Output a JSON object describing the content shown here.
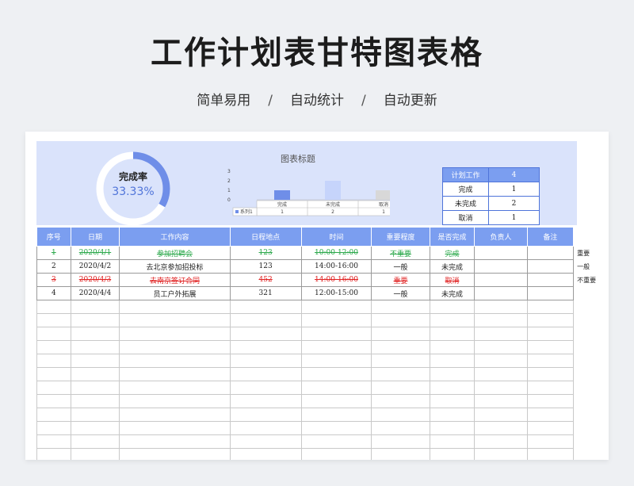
{
  "header": {
    "title": "工作计划表甘特图表格",
    "tags": [
      "简单易用",
      "自动统计",
      "自动更新"
    ],
    "separator": "/"
  },
  "gauge": {
    "label": "完成率",
    "value_text": "33.33%",
    "fraction": 0.3333,
    "colors": {
      "arc": "#6f8ee8",
      "track": "#ffffff"
    }
  },
  "chart_data": {
    "type": "bar",
    "title": "图表标题",
    "categories": [
      "完成",
      "未完成",
      "取消"
    ],
    "series": [
      {
        "name": "系列1",
        "values": [
          1,
          2,
          1
        ]
      }
    ],
    "ylim": [
      0,
      3
    ],
    "yticks": [
      "0",
      "1",
      "2",
      "3"
    ],
    "bar_colors": [
      "#6f8ee8",
      "#c6d4fb",
      "#d8d8d8"
    ],
    "legend": "bottom-table"
  },
  "stats": {
    "header": [
      "计划工作",
      "4"
    ],
    "rows": [
      [
        "完成",
        "1"
      ],
      [
        "未完成",
        "2"
      ],
      [
        "取消",
        "1"
      ]
    ]
  },
  "table": {
    "columns": [
      "序号",
      "日期",
      "工作内容",
      "日程地点",
      "时间",
      "重要程度",
      "是否完成",
      "负责人",
      "备注"
    ],
    "rows": [
      {
        "status": "done",
        "cells": [
          "1",
          "2020/4/1",
          "参加招聘会",
          "123",
          "10:00-12:00",
          "不重要",
          "完成",
          "",
          ""
        ],
        "side": "重要"
      },
      {
        "status": "open",
        "cells": [
          "2",
          "2020/4/2",
          "去北京参加招投标",
          "123",
          "14:00-16:00",
          "一般",
          "未完成",
          "",
          ""
        ],
        "side": "一般"
      },
      {
        "status": "cancel",
        "cells": [
          "3",
          "2020/4/3",
          "去南京签订合同",
          "452",
          "14:00-16:00",
          "重要",
          "取消",
          "",
          ""
        ],
        "side": "不重要"
      },
      {
        "status": "open",
        "cells": [
          "4",
          "2020/4/4",
          "员工户外拓展",
          "321",
          "12:00-15:00",
          "一般",
          "未完成",
          "",
          ""
        ],
        "side": ""
      }
    ],
    "empty_rows": 12,
    "status_colors": {
      "done": "#2aa84a",
      "cancel": "#e02020"
    }
  },
  "colors": {
    "header_blue": "#7b9ef0",
    "dash_bg": "#dae3fb",
    "accent": "#4f74d9"
  }
}
